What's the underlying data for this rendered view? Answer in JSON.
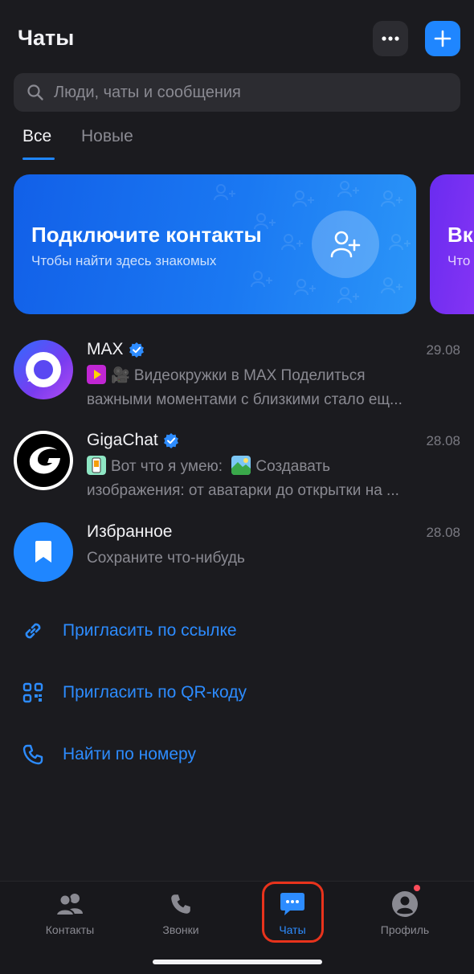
{
  "header": {
    "title": "Чаты",
    "more_icon": "more-horizontal-icon",
    "add_icon": "plus-icon"
  },
  "search": {
    "placeholder": "Люди, чаты и сообщения"
  },
  "tabs": [
    {
      "label": "Все",
      "active": true
    },
    {
      "label": "Новые",
      "active": false
    }
  ],
  "banners": [
    {
      "title": "Подключите контакты",
      "subtitle": "Чтобы найти здесь знакомых",
      "icon": "add-user-icon"
    },
    {
      "title": "Вк",
      "subtitle": "Что"
    }
  ],
  "chats": [
    {
      "name": "MAX",
      "verified": true,
      "date": "29.08",
      "line1": "🎥 Видеокружки в MAX Поделиться",
      "line2": "важными моментами с близкими стало ещ..."
    },
    {
      "name": "GigaChat",
      "verified": true,
      "date": "28.08",
      "line1_a": "Вот что я умею:",
      "line1_b": "Создавать",
      "line2": "изображения: от аватарки до открытки на ..."
    },
    {
      "name": "Избранное",
      "verified": false,
      "date": "28.08",
      "line1": "Сохраните что-нибудь"
    }
  ],
  "actions": [
    {
      "label": "Пригласить по ссылке",
      "icon": "link-icon"
    },
    {
      "label": "Пригласить по QR-коду",
      "icon": "qr-code-icon"
    },
    {
      "label": "Найти по номеру",
      "icon": "phone-icon"
    }
  ],
  "bottom_nav": [
    {
      "label": "Контакты",
      "icon": "contacts-icon"
    },
    {
      "label": "Звонки",
      "icon": "phone-icon"
    },
    {
      "label": "Чаты",
      "icon": "chat-bubble-icon",
      "active": true
    },
    {
      "label": "Профиль",
      "icon": "profile-icon",
      "badge": "notification-dot"
    }
  ],
  "colors": {
    "background": "#1b1b1f",
    "accent": "#1f86ff",
    "link": "#2d8cff",
    "muted_text": "#8a8a92",
    "highlight_ring": "#e8331c"
  }
}
